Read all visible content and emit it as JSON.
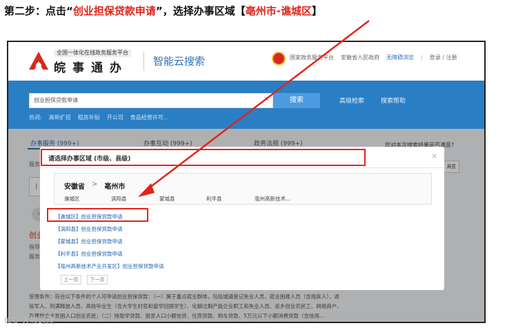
{
  "instruction": {
    "prefix": "第二步：点击“",
    "highlight_1": "创业担保贷款申请",
    "middle": "”，选择办事区域【",
    "highlight_2": "亳州市-谯城区",
    "suffix": "】"
  },
  "header": {
    "platform_subtitle": "全国一体化在线政务服务平台",
    "site_name": "皖事通办",
    "search_brand": "智能云搜索",
    "links": [
      "国家政务服务平台",
      "安徽省人民政府",
      "无障碍浏览",
      "登录 / 注册"
    ]
  },
  "search": {
    "query": "创业担保贷款申请",
    "button": "搜索",
    "advanced": "高级检索",
    "help": "搜索帮助",
    "hot_label": "热词:",
    "hot_words": [
      "高新扩招",
      "租房补贴",
      "开公司",
      "食品经营许可..."
    ]
  },
  "tabs": [
    {
      "label": "办事服务 (999+)"
    },
    {
      "label": "办事互动 (999+)"
    },
    {
      "label": "政务法规 (999+)"
    }
  ],
  "background": {
    "left_label": "服务",
    "result_link": "创业",
    "guide_label": "指导",
    "service_label": "服务对",
    "question": "您对本次搜索结果是否满意?",
    "satisfied": "满意",
    "desc_lines": [
      "受理条件：符合以下条件的个人可申请创业担保贷款：（一）属于重点就业群体，包括城镇登记失业人员、就业困难人员（含残疾人）、退",
      "役军人、刑满释放人员、高校毕业生（含大学生村官和留学回国学生）、化解过剩产能企业职工和失业人员、返乡创业农民工、网络商户、",
      "          及建档立卡贫困人口创业农民；（二）除助学贷款、脱贫人口小额信贷、住房贷款、购车贷款、5万元以下小额消费贷款（含信用..."
    ]
  },
  "modal": {
    "title": "请选择办事区域 (市级、县级)",
    "close": "×",
    "province": "安徽省",
    "chevron": ">",
    "city": "亳州市",
    "counties": [
      "谯城区",
      "涡阳县",
      "蒙城县",
      "利辛县",
      "亳州高新技术..."
    ],
    "apply_links": [
      "【谯城区】创业担保贷款申请",
      "【涡阳县】创业担保贷款申请",
      "【蒙城县】创业担保贷款申请",
      "【利辛县】创业担保贷款申请",
      "【亳州高新技术产业开发区】创业担保贷款申请"
    ],
    "prev": "上一页",
    "next": "下一页"
  },
  "watermark": "ICO 大族跨境",
  "colors": {
    "accent_red": "#e2231a",
    "banner_blue": "#2a7ec4",
    "link_blue": "#1e61b0"
  }
}
